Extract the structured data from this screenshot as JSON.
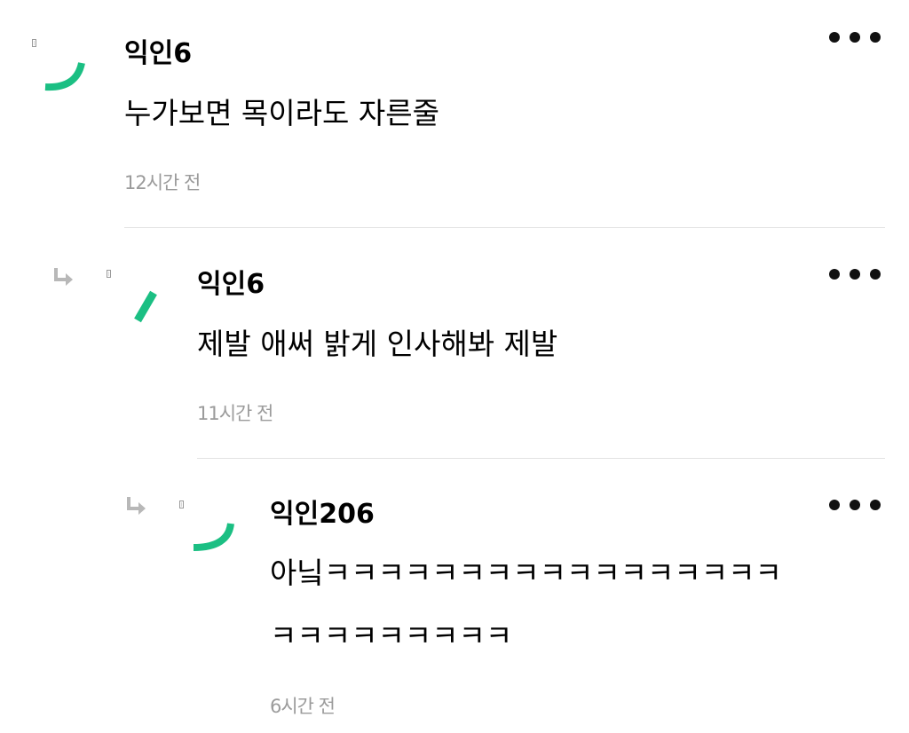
{
  "colors": {
    "avatar_accent": "#1bbf83",
    "time_text": "#9b9b9b",
    "divider": "#e2e2e2",
    "reply_arrow": "#b8b8b8"
  },
  "comments": [
    {
      "author": "익인6",
      "text": "누가보면 목이라도 자른줄",
      "time": "12시간 전",
      "more_icon": "more-horizontal-icon"
    },
    {
      "author": "익인6",
      "text": "제발 애써 밝게 인사해봐 제발",
      "time": "11시간 전",
      "reply_icon": "reply-arrow-icon",
      "more_icon": "more-horizontal-icon"
    },
    {
      "author": "익인206",
      "text_line1": "아닠ㅋㅋㅋㅋㅋㅋㅋㅋㅋㅋㅋㅋㅋㅋㅋㅋㅋ",
      "text_line2": "ㅋㅋㅋㅋㅋㅋㅋㅋㅋ",
      "time": "6시간 전",
      "reply_icon": "reply-arrow-icon",
      "more_icon": "more-horizontal-icon"
    }
  ]
}
